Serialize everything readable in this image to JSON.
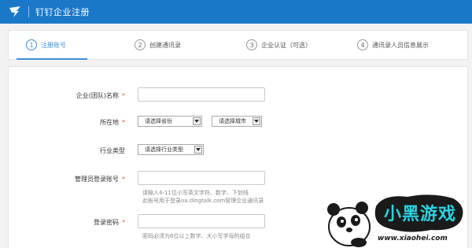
{
  "header": {
    "title": "钉钉企业注册",
    "bg_color": "#1b78c8"
  },
  "steps": [
    {
      "num": "1",
      "label": "注册账号",
      "active": true
    },
    {
      "num": "2",
      "label": "创建通讯录",
      "active": false
    },
    {
      "num": "3",
      "label": "企业认证（可选）",
      "active": false
    },
    {
      "num": "4",
      "label": "通讯录人员信息展示",
      "active": false
    }
  ],
  "form": {
    "company_name": {
      "label": "企业(团队)名称",
      "required": "*",
      "value": ""
    },
    "location": {
      "label": "所在地",
      "required": "*",
      "province": "请选择省份",
      "city": "请选择城市"
    },
    "industry": {
      "label": "行业类型",
      "value": "请选择行业类型"
    },
    "admin_account": {
      "label": "管理员登录账号",
      "required": "*",
      "value": "",
      "hint_line1": "请输入4-11位小写英文字符、数字、下划线",
      "hint_line2": "此帐号用于登录oa.dingtalk.com管理企业通讯录"
    },
    "password": {
      "label": "登录密码",
      "required": "*",
      "value": "",
      "hint": "密码必须为6位以上数字、大小写字母的组合"
    }
  },
  "watermark": {
    "logo_text": "小黑游戏",
    "url": "www.xiaohei.com"
  }
}
